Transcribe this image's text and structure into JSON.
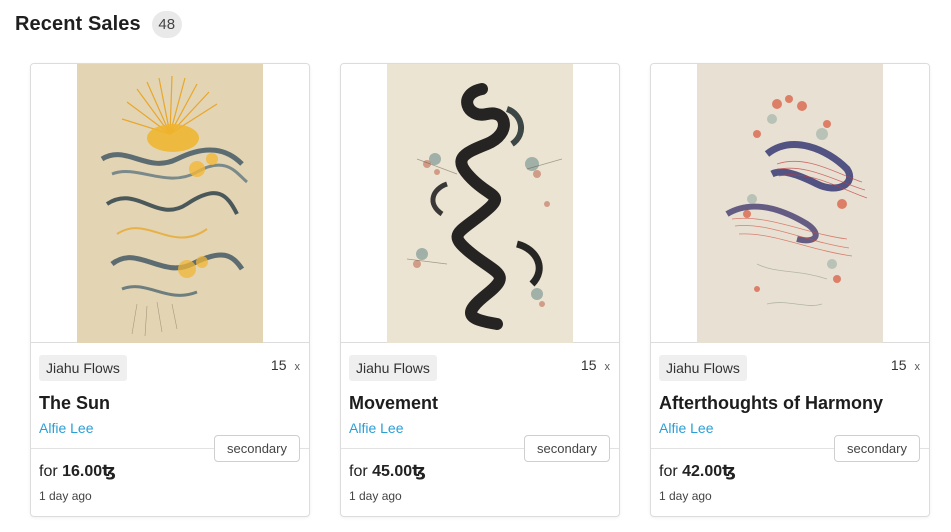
{
  "header": {
    "title": "Recent Sales",
    "count": "48"
  },
  "cards": [
    {
      "collection": "Jiahu Flows",
      "edition": "15",
      "edition_suffix": "x",
      "title": "The Sun",
      "artist": "Alfie Lee",
      "tag": "secondary",
      "price_prefix": "for",
      "price": "16.00ꜩ",
      "time": "1 day ago",
      "image_alt": "ink-artwork"
    },
    {
      "collection": "Jiahu Flows",
      "edition": "15",
      "edition_suffix": "x",
      "title": "Movement",
      "artist": "Alfie Lee",
      "tag": "secondary",
      "price_prefix": "for",
      "price": "45.00ꜩ",
      "time": "1 day ago",
      "image_alt": "ink-artwork"
    },
    {
      "collection": "Jiahu Flows",
      "edition": "15",
      "edition_suffix": "x",
      "title": "Afterthoughts of Harmony",
      "artist": "Alfie Lee",
      "tag": "secondary",
      "price_prefix": "for",
      "price": "42.00ꜩ",
      "time": "1 day ago",
      "image_alt": "ink-artwork"
    }
  ],
  "colors": {
    "accent_link": "#2a9fd6",
    "chip_bg": "#efefef",
    "badge_bg": "#e9e9e9"
  }
}
